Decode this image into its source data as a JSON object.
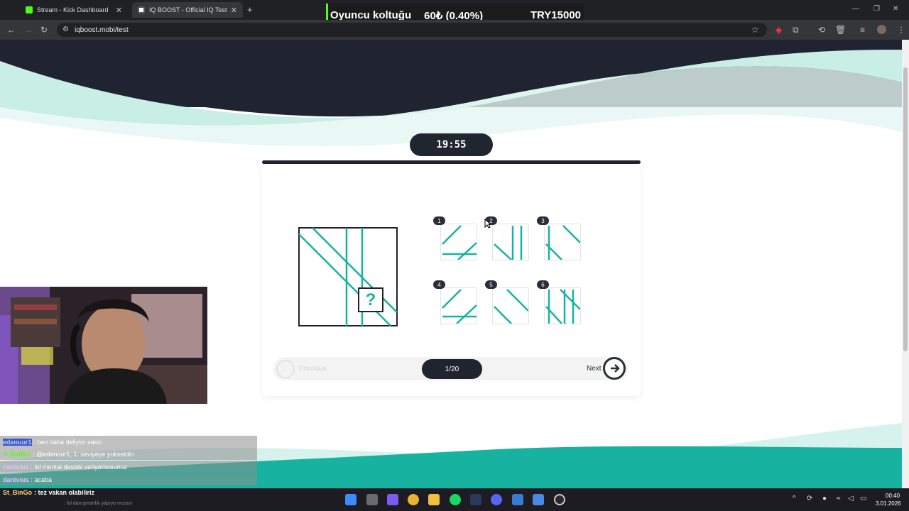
{
  "browser": {
    "tabs": [
      {
        "label": "Stream - Kick Dashboard",
        "icon": "kick-icon",
        "active": false
      },
      {
        "label": "IQ BOOST - Official IQ Test",
        "icon": "iq-boost-icon",
        "active": true
      }
    ],
    "url": "iqboost.mobi/test"
  },
  "overlay": {
    "label": "Oyuncu koltuğu",
    "value": "60₺ (0.40%)",
    "prize": "TRY15000"
  },
  "test": {
    "timer": "19:55",
    "puzzle_placeholder": "?",
    "options": [
      {
        "number": "1"
      },
      {
        "number": "2"
      },
      {
        "number": "3"
      },
      {
        "number": "4"
      },
      {
        "number": "5"
      },
      {
        "number": "6"
      }
    ],
    "previous_label": "Previous",
    "next_label": "Next",
    "counter": "1/20"
  },
  "chat": [
    {
      "user": "edanuur1",
      "message": ": ben daha deliyim sakin",
      "user_color": "#6a8cff"
    },
    {
      "user": "BotRix",
      "message": ": @edanuur1, 1. seviyeye yukseldin",
      "user_color": "#53fc18"
    },
    {
      "user": "danivius",
      "message": ": lol mental destek veriyomusunuz",
      "user_color": "#d9a6ff"
    },
    {
      "user": "danivius",
      "message": ": acaba",
      "user_color": "#d9a6ff"
    }
  ],
  "chat_last": {
    "user": "St_BinGo",
    "message": ": tez vakan olabiliriz"
  },
  "chat_faded": ": lol danışmanlık yapıyo musun",
  "taskbar": {
    "time": "00:40",
    "date": "3.01.2026"
  },
  "colors": {
    "accent": "#17b3a0",
    "wave_dark": "#1f2430",
    "pill": "#20242f"
  }
}
